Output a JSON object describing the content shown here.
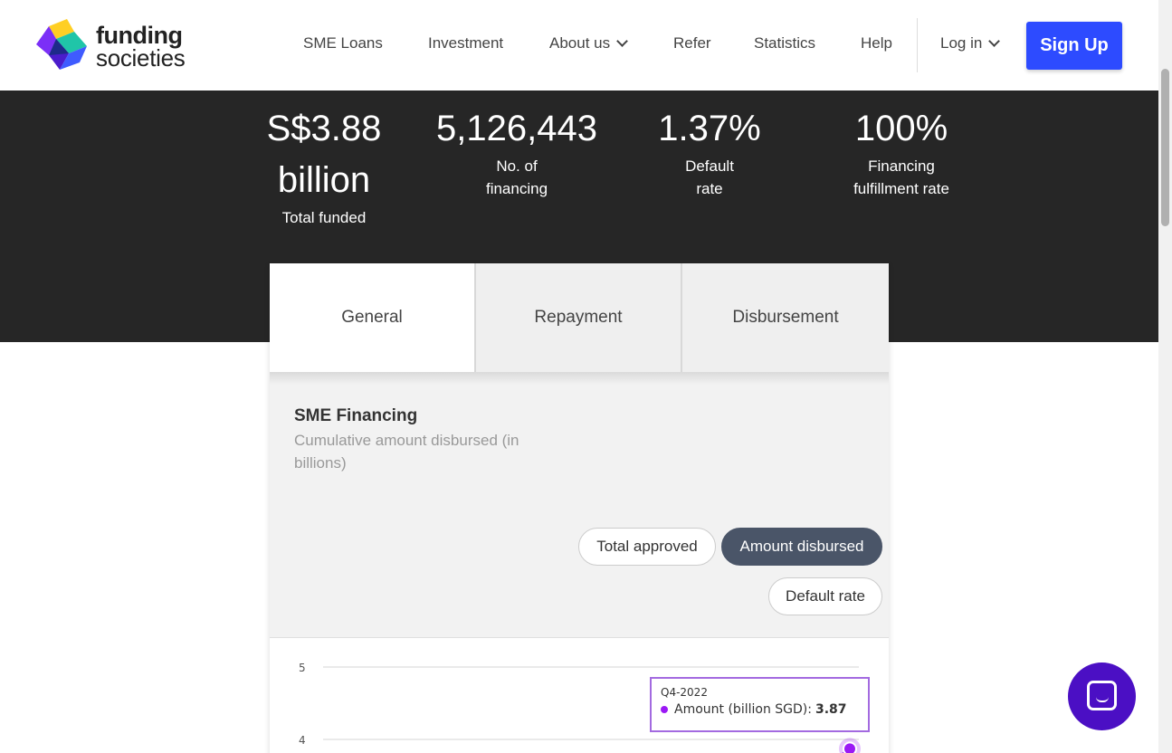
{
  "header": {
    "logo": {
      "line1": "funding",
      "line2": "societies"
    },
    "nav": [
      {
        "label": "SME Loans"
      },
      {
        "label": "Investment"
      },
      {
        "label": "About us"
      },
      {
        "label": "Refer"
      },
      {
        "label": "Statistics"
      },
      {
        "label": "Help"
      },
      {
        "label": "Log in"
      }
    ],
    "signup_label": "Sign Up"
  },
  "stats": [
    {
      "value": "S$3.88",
      "value2": "billion",
      "label": "Total funded"
    },
    {
      "value": "5,126,443",
      "label1": "No. of",
      "label2": "financing"
    },
    {
      "value": "1.37%",
      "label1": "Default",
      "label2": "rate"
    },
    {
      "value": "100%",
      "label1": "Financing",
      "label2": "fulfillment rate"
    }
  ],
  "tabs": [
    {
      "label": "General",
      "active": true
    },
    {
      "label": "Repayment",
      "active": false
    },
    {
      "label": "Disbursement",
      "active": false
    }
  ],
  "section": {
    "title": "SME Financing",
    "subtitle": "Cumulative amount disbursed (in billions)"
  },
  "filters": [
    {
      "label": "Total approved",
      "selected": false
    },
    {
      "label": "Amount disbursed",
      "selected": true
    },
    {
      "label": "Default rate",
      "selected": false
    }
  ],
  "chart_data": {
    "type": "line",
    "y_ticks": [
      "5",
      "4"
    ],
    "ylim": [
      4,
      5
    ],
    "series": [
      {
        "name": "Amount (billion SGD)",
        "color": "#9b19f5",
        "points": [
          {
            "x": "Q4-2022",
            "y": 3.87
          }
        ]
      }
    ],
    "tooltip": {
      "title": "Q4-2022",
      "label": "Amount (billion SGD):",
      "value": "3.87"
    }
  },
  "colors": {
    "brand_blue": "#2d4bff",
    "band_bg": "#262626",
    "series_purple": "#9b19f5",
    "chat_purple": "#4b0fc4"
  }
}
